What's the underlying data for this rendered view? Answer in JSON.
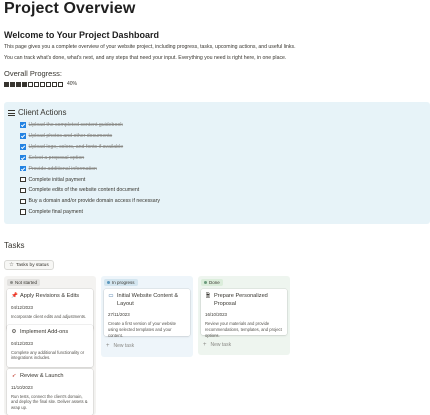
{
  "page": {
    "title": "Project Overview",
    "welcome_heading": "Welcome to Your Project Dashboard",
    "intro_line1": "This page gives you a complete overview of your website project, including progress, tasks, upcoming actions, and useful links.",
    "intro_line2": "You can track what's done, what's next, and any steps that need your input. Everything you need is right here, in one place."
  },
  "progress": {
    "label": "Overall Progress:",
    "percent_text": "40%",
    "value": 0.4,
    "segments_filled": 4,
    "segments_total": 10
  },
  "client_actions": {
    "title": "Client Actions",
    "icon": "list-icon",
    "items": [
      {
        "label": "Upload the completed content guidebook",
        "checked": true
      },
      {
        "label": "Upload photos and other documents",
        "checked": true
      },
      {
        "label": "Upload logo, colors, and fonts if available",
        "checked": true
      },
      {
        "label": "Select a proposal option",
        "checked": true
      },
      {
        "label": "Provide additional information",
        "checked": true
      },
      {
        "label": "Complete initial payment",
        "checked": false
      },
      {
        "label": "Complete edits of the website content document",
        "checked": false
      },
      {
        "label": "Buy a domain and/or provide domain access if necessary",
        "checked": false
      },
      {
        "label": "Complete final payment",
        "checked": false
      }
    ]
  },
  "tasks": {
    "heading": "Tasks",
    "view_label": "Tasks by status",
    "view_icon": "star-icon",
    "new_task_label": "New task",
    "columns": [
      {
        "status": "Not started",
        "color": "#91918e",
        "cards": [
          {
            "icon": "pin-icon",
            "title": "Apply Revisions & Edits",
            "date": "04/12/2023",
            "desc": "Incorporate client edits and adjustments."
          },
          {
            "icon": "gear-icon",
            "title": "Implement Add-ons",
            "date": "04/12/2023",
            "desc": "Complete any additional functionality or integrations includes."
          },
          {
            "icon": "rocket-icon",
            "title": "Review & Launch",
            "date": "11/10/2023",
            "desc": "Run tests, connect the client's domain, and deploy the final site. Deliver assets & wrap up."
          }
        ]
      },
      {
        "status": "In progress",
        "color": "#5b97bd",
        "cards": [
          {
            "icon": "monitor-icon",
            "title": "Initial Website Content & Layout",
            "date": "27/11/2023",
            "desc": "Create a first version of your website using selected templates and your content."
          }
        ]
      },
      {
        "status": "Done",
        "color": "#6c9b7d",
        "cards": [
          {
            "icon": "document-icon",
            "title": "Prepare Personalized Proposal",
            "date": "16/10/2023",
            "desc": "Review your materials and provide recommendations, templates, and project options."
          }
        ]
      }
    ]
  }
}
